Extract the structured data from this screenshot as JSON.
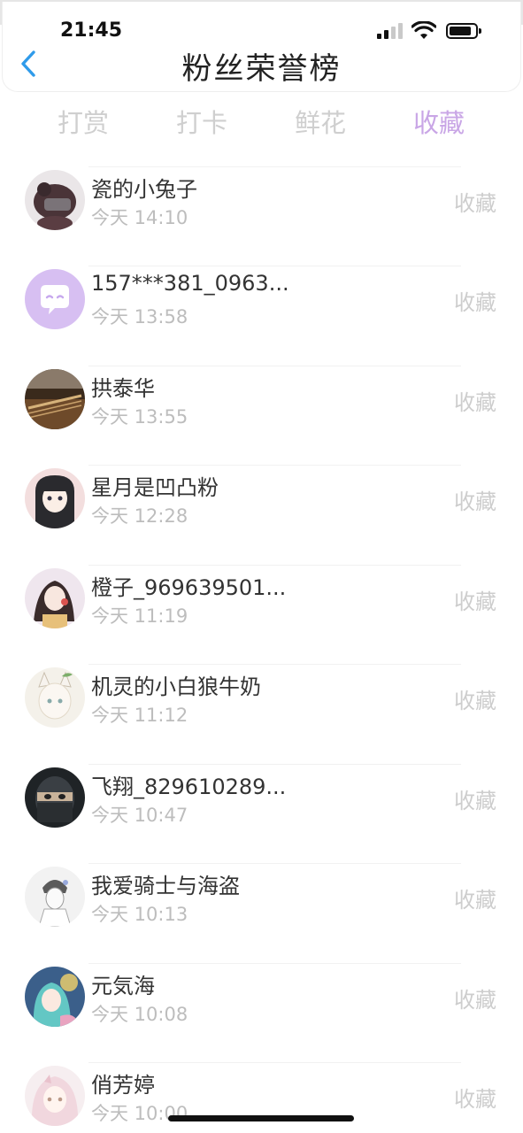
{
  "status_bar": {
    "time": "21:45"
  },
  "header": {
    "title": "粉丝荣誉榜"
  },
  "tabs": [
    {
      "label": "打赏",
      "active": false
    },
    {
      "label": "打卡",
      "active": false
    },
    {
      "label": "鲜花",
      "active": false
    },
    {
      "label": "收藏",
      "active": true
    }
  ],
  "colors": {
    "accent_tab": "#c9a6e6",
    "back_icon": "#2f9bea",
    "muted_text": "#bdbdbd"
  },
  "fans": [
    {
      "name": "瓷的小兔子",
      "time": "今天 14:10",
      "action": "收藏",
      "avatar_icon": "dark-mask-avatar"
    },
    {
      "name": "157***381_0963...",
      "time": "今天 13:58",
      "action": "收藏",
      "avatar_icon": "default-purple-avatar"
    },
    {
      "name": "拱泰华",
      "time": "今天 13:55",
      "action": "收藏",
      "avatar_icon": "guzheng-avatar"
    },
    {
      "name": "星月是凹凸粉",
      "time": "今天 12:28",
      "action": "收藏",
      "avatar_icon": "anime-girl-avatar"
    },
    {
      "name": "橙子_969639501...",
      "time": "今天 11:19",
      "action": "收藏",
      "avatar_icon": "anime-girl-avatar"
    },
    {
      "name": "机灵的小白狼牛奶",
      "time": "今天 11:12",
      "action": "收藏",
      "avatar_icon": "anime-cat-avatar"
    },
    {
      "name": "飞翔_829610289...",
      "time": "今天 10:47",
      "action": "收藏",
      "avatar_icon": "ninja-avatar"
    },
    {
      "name": "我爱骑士与海盗",
      "time": "今天 10:13",
      "action": "收藏",
      "avatar_icon": "sketch-avatar"
    },
    {
      "name": "元気海",
      "time": "今天 10:08",
      "action": "收藏",
      "avatar_icon": "anime-blue-avatar"
    },
    {
      "name": "俏芳婷",
      "time": "今天 10:00",
      "action": "收藏",
      "avatar_icon": "anime-pink-avatar"
    }
  ]
}
